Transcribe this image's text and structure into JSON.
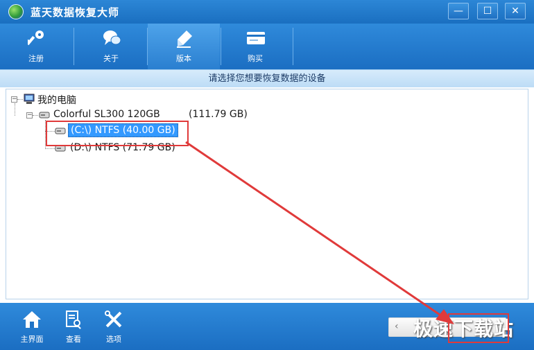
{
  "window": {
    "title": "蓝天数据恢复大师",
    "minimize": "—",
    "maximize": "☐",
    "close": "✕"
  },
  "toolbar": {
    "items": [
      {
        "label": "注册",
        "icon": "key-icon"
      },
      {
        "label": "关于",
        "icon": "chat-bubbles-icon"
      },
      {
        "label": "版本",
        "icon": "pen-icon"
      },
      {
        "label": "购买",
        "icon": "card-icon"
      }
    ]
  },
  "subheader": {
    "text": "请选择您想要恢复数据的设备"
  },
  "tree": {
    "root": "我的电脑",
    "disk": {
      "name": "Colorful SL300 120GB",
      "size": "(111.79 GB)"
    },
    "partitions": [
      {
        "label": "(C:\\) NTFS (40.00 GB)",
        "selected": true
      },
      {
        "label": "(D:\\) NTFS (71.79 GB)",
        "selected": false
      }
    ]
  },
  "bottombar": {
    "items": [
      {
        "label": "主界面",
        "icon": "home-icon"
      },
      {
        "label": "查看",
        "icon": "document-search-icon"
      },
      {
        "label": "选项",
        "icon": "tools-icon"
      }
    ],
    "next_button_chevron": "‹",
    "watermark": "极速下载站"
  },
  "colors": {
    "accent": "#1b6ec2",
    "selection": "#3399ff",
    "annotation": "#e03a3a"
  }
}
